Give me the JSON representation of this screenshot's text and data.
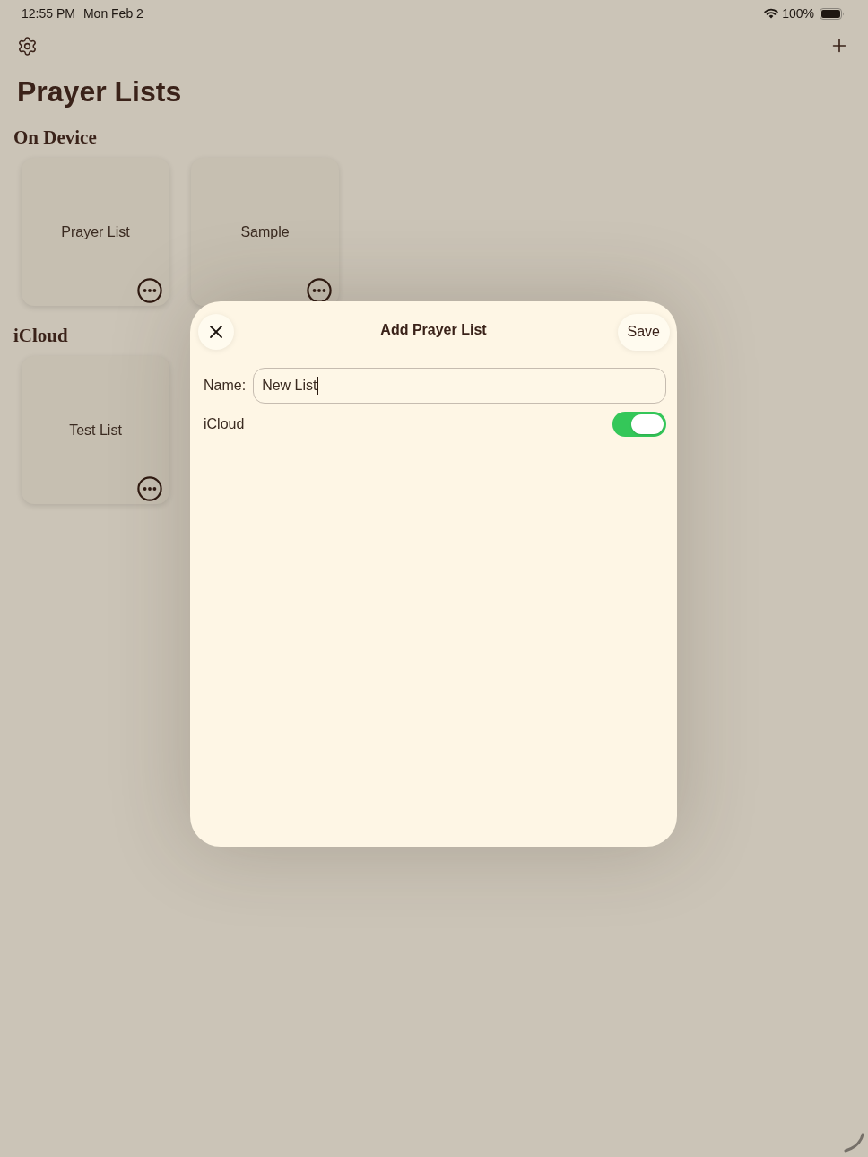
{
  "status_bar": {
    "time": "12:55 PM",
    "date": "Mon Feb 2",
    "battery": "100%"
  },
  "title": "Prayer Lists",
  "sections": [
    {
      "heading": "On Device",
      "lists": [
        {
          "name": "Prayer List"
        },
        {
          "name": "Sample"
        }
      ]
    },
    {
      "heading": "iCloud",
      "lists": [
        {
          "name": "Test List"
        }
      ]
    }
  ],
  "dialog": {
    "title": "Add Prayer List",
    "save_label": "Save",
    "fields": [
      {
        "kind": "text",
        "label": "Name:",
        "value": "New List",
        "focused": true
      },
      {
        "kind": "toggle",
        "label": "iCloud",
        "on": true
      }
    ]
  }
}
